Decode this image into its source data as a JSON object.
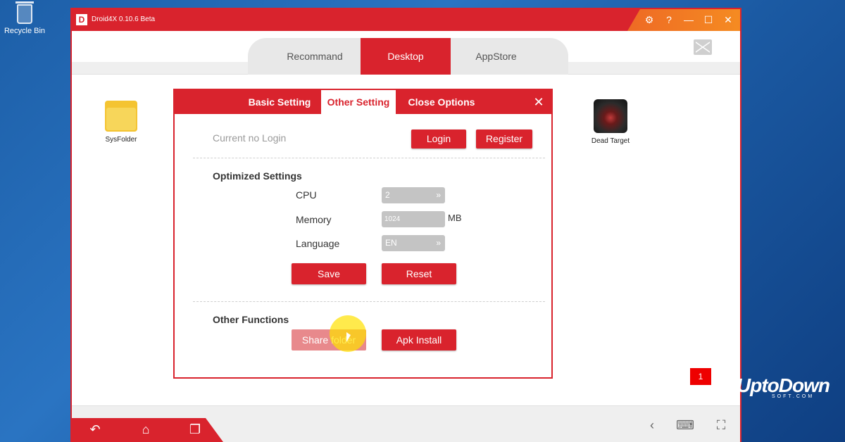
{
  "desktop": {
    "recycle_bin_label": "Recycle Bin"
  },
  "window": {
    "title": "Droid4X 0.10.6 Beta",
    "controls": {
      "settings": "⚙",
      "help": "?",
      "minimize": "—",
      "maximize": "☐",
      "close": "✕"
    }
  },
  "top_tabs": [
    {
      "label": "Recommand",
      "active": false
    },
    {
      "label": "Desktop",
      "active": true
    },
    {
      "label": "AppStore",
      "active": false
    }
  ],
  "apps": [
    {
      "label": "SysFolder",
      "icon": "folder-icon"
    },
    {
      "label": "Dead Target",
      "icon": "game-icon"
    }
  ],
  "dialog": {
    "tabs": [
      {
        "label": "Basic Setting",
        "active": false
      },
      {
        "label": "Other Setting",
        "active": true
      },
      {
        "label": "Close Options",
        "active": false
      }
    ],
    "close": "✕",
    "login_status": "Current no Login",
    "login_label": "Login",
    "register_label": "Register",
    "optimized": {
      "title": "Optimized Settings",
      "cpu_label": "CPU",
      "cpu_value": "2",
      "memory_label": "Memory",
      "memory_value": "1024",
      "memory_unit": "MB",
      "language_label": "Language",
      "language_value": "EN",
      "save_label": "Save",
      "reset_label": "Reset"
    },
    "functions": {
      "title": "Other Functions",
      "share_label": "Share folder",
      "apk_label": "Apk Install"
    }
  },
  "notification_count": "1",
  "bottom_nav": {
    "back": "↶",
    "home": "⌂",
    "recent": "❐",
    "prev": "‹",
    "keyboard": "⌨",
    "fullscreen": "⛶"
  },
  "watermark": {
    "brand": "UptoDown",
    "sub": "SOFT.COM"
  },
  "colors": {
    "accent": "#d9232d",
    "accent_orange": "#f58b22",
    "desktop_blue": "#1d5fa8"
  }
}
